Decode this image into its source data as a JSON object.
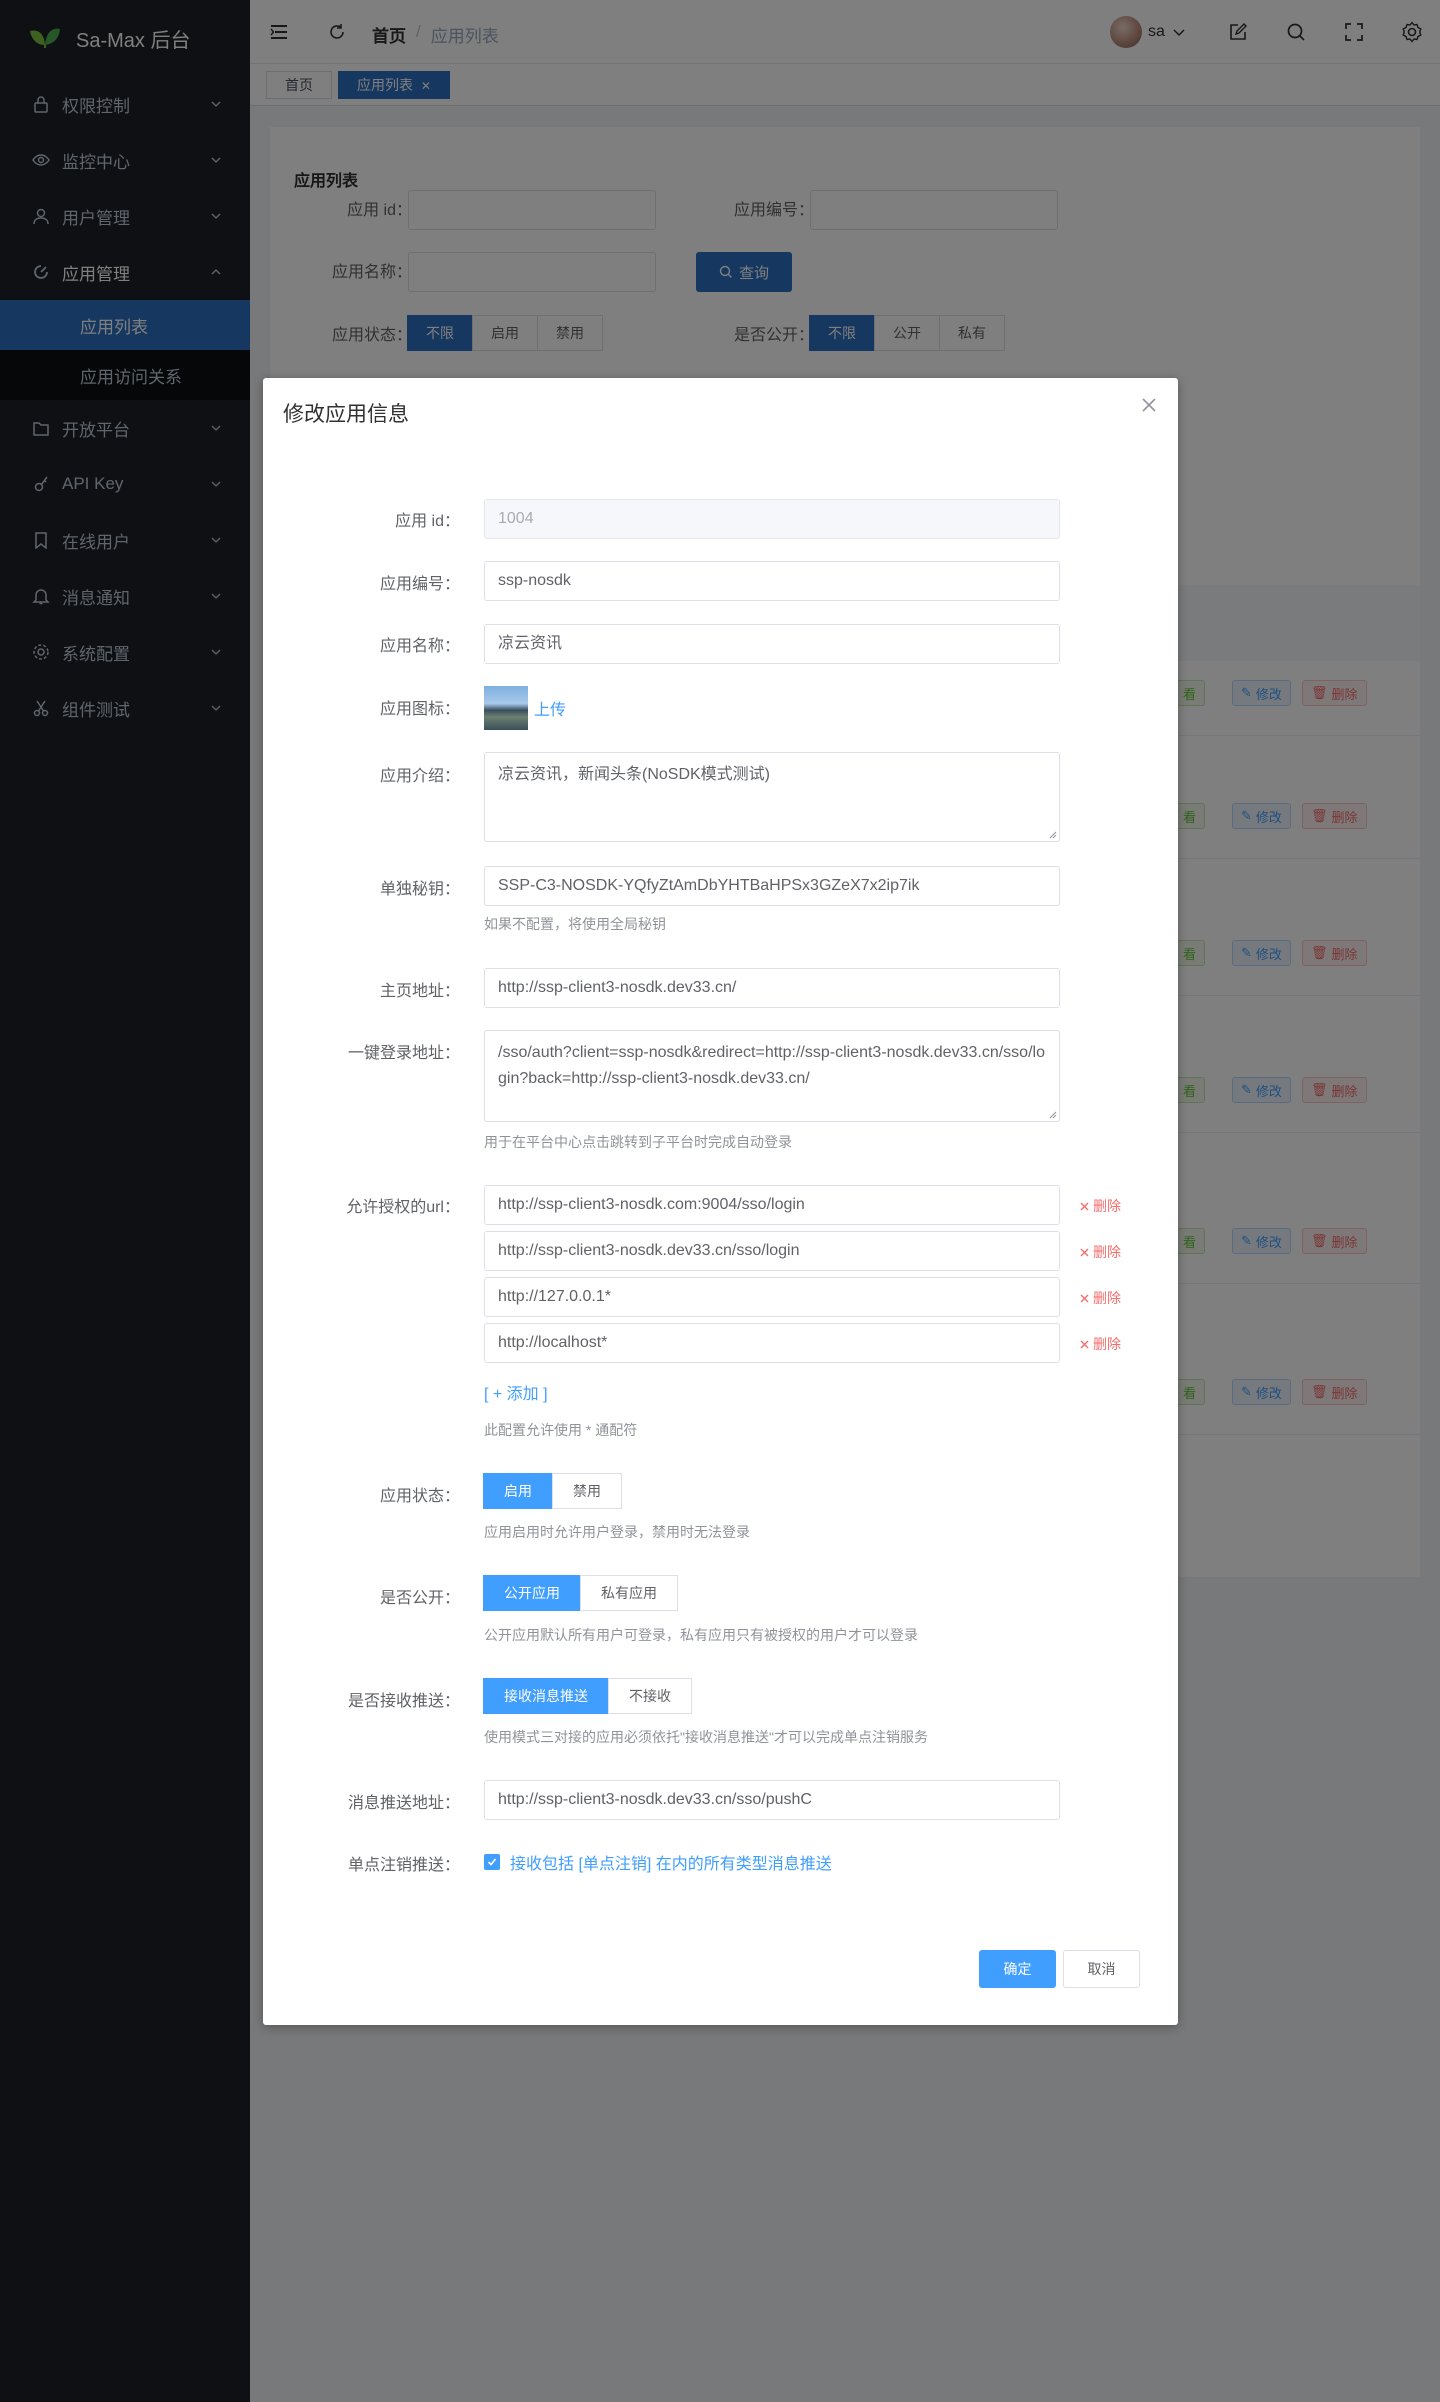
{
  "app": {
    "title": "Sa-Max 后台"
  },
  "sidebar": {
    "items": [
      {
        "label": "权限控制",
        "icon": "lock-icon"
      },
      {
        "label": "监控中心",
        "icon": "eye-icon"
      },
      {
        "label": "用户管理",
        "icon": "user-icon"
      },
      {
        "label": "应用管理",
        "icon": "apps-icon"
      },
      {
        "label": "开放平台",
        "icon": "folder-icon"
      },
      {
        "label": "API Key",
        "icon": "key-icon"
      },
      {
        "label": "在线用户",
        "icon": "bookmark-icon"
      },
      {
        "label": "消息通知",
        "icon": "bell-icon"
      },
      {
        "label": "系统配置",
        "icon": "gear-icon"
      },
      {
        "label": "组件测试",
        "icon": "scissors-icon"
      }
    ],
    "subitems": [
      {
        "label": "应用列表",
        "active": true
      },
      {
        "label": "应用访问关系",
        "active": false
      }
    ]
  },
  "header": {
    "breadcrumb": [
      "首页",
      "应用列表"
    ],
    "separator": "/",
    "username": "sa"
  },
  "tabs": [
    {
      "label": "首页",
      "active": false
    },
    {
      "label": "应用列表",
      "active": true
    }
  ],
  "filter": {
    "title": "应用列表",
    "app_id_label": "应用 id：",
    "app_code_label": "应用编号：",
    "app_name_label": "应用名称：",
    "query_button": "查询",
    "status_label": "应用状态：",
    "status_options": [
      "不限",
      "启用",
      "禁用"
    ],
    "public_label": "是否公开：",
    "public_options": [
      "不限",
      "公开",
      "私有"
    ]
  },
  "row_actions": {
    "view": "看",
    "edit": "修改",
    "delete": "删除"
  },
  "dialog": {
    "title": "修改应用信息",
    "fields": {
      "app_id": {
        "label": "应用 id：",
        "value": "1004"
      },
      "app_code": {
        "label": "应用编号：",
        "value": "ssp-nosdk"
      },
      "app_name": {
        "label": "应用名称：",
        "value": "凉云资讯"
      },
      "app_icon": {
        "label": "应用图标：",
        "upload": "上传"
      },
      "app_intro": {
        "label": "应用介绍：",
        "value": "凉云资讯，新闻头条(NoSDK模式测试)"
      },
      "secret": {
        "label": "单独秘钥：",
        "value": "SSP-C3-NOSDK-YQfyZtAmDbYHTBaHPSx3GZeX7x2ip7ik",
        "hint": "如果不配置，将使用全局秘钥"
      },
      "home_url": {
        "label": "主页地址：",
        "value": "http://ssp-client3-nosdk.dev33.cn/"
      },
      "login_url": {
        "label": "一键登录地址：",
        "value": "/sso/auth?client=ssp-nosdk&redirect=http://ssp-client3-nosdk.dev33.cn/sso/login?back=http://ssp-client3-nosdk.dev33.cn/",
        "hint": "用于在平台中心点击跳转到子平台时完成自动登录"
      },
      "allow_urls": {
        "label": "允许授权的url：",
        "values": [
          "http://ssp-client3-nosdk.com:9004/sso/login",
          "http://ssp-client3-nosdk.dev33.cn/sso/login",
          "http://127.0.0.1*",
          "http://localhost*"
        ],
        "delete_label": "删除",
        "add_label": "[ + 添加 ]",
        "hint": "此配置允许使用 * 通配符"
      },
      "status": {
        "label": "应用状态：",
        "options": [
          "启用",
          "禁用"
        ],
        "selected": "启用",
        "hint": "应用启用时允许用户登录，禁用时无法登录"
      },
      "is_public": {
        "label": "是否公开：",
        "options": [
          "公开应用",
          "私有应用"
        ],
        "selected": "公开应用",
        "hint": "公开应用默认所有用户可登录，私有应用只有被授权的用户才可以登录"
      },
      "receive_push": {
        "label": "是否接收推送：",
        "options": [
          "接收消息推送",
          "不接收"
        ],
        "selected": "接收消息推送",
        "hint": "使用模式三对接的应用必须依托\"接收消息推送\"才可以完成单点注销服务"
      },
      "push_url": {
        "label": "消息推送地址：",
        "value": "http://ssp-client3-nosdk.dev33.cn/sso/pushC"
      },
      "logout_push": {
        "label": "单点注销推送：",
        "checkbox_label": "接收包括 [单点注销] 在内的所有类型消息推送",
        "checked": true
      }
    },
    "ok_button": "确定",
    "cancel_button": "取消"
  },
  "colors": {
    "sidebar_bg": "#1f2127",
    "active_blue": "#2d6ec0",
    "primary": "#409eff",
    "danger": "#f56c6c",
    "success": "#67c23a"
  }
}
